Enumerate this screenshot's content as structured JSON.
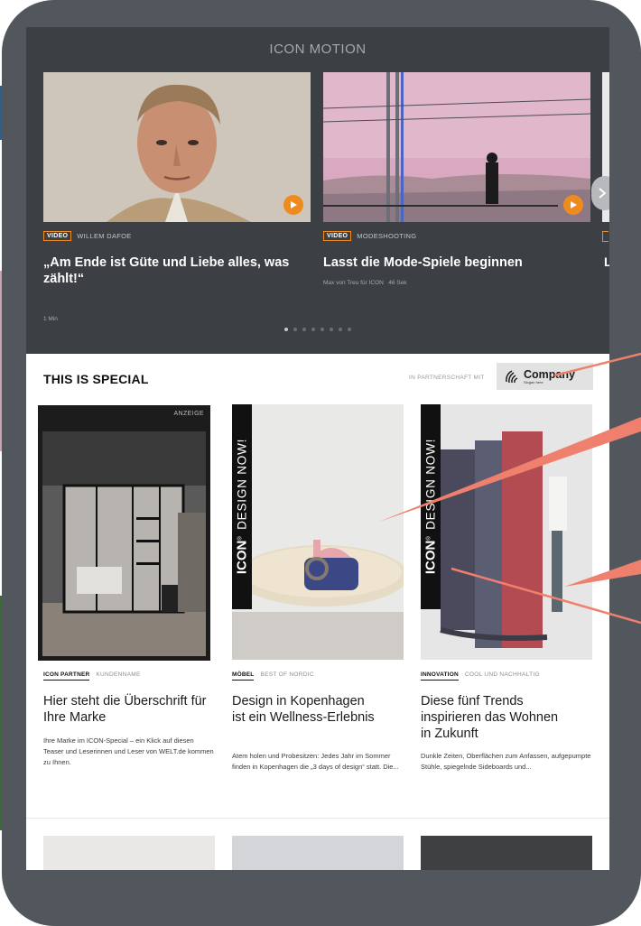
{
  "motion": {
    "title": "ICON MOTION",
    "cards": [
      {
        "tag": "VIDEO",
        "category": "WILLEM DAFOE",
        "headline": "„Am Ende ist Güte und Liebe alles, was zählt!“",
        "meta": "",
        "duration": "1 Min"
      },
      {
        "tag": "VIDEO",
        "category": "MODESHOOTING",
        "headline": "Lasst die Mode-Spiele beginnen",
        "meta": "Max von Treu für ICON",
        "duration": "46 Sek"
      }
    ],
    "peek_letter": "L",
    "dots_total": 8,
    "dots_active": 1
  },
  "special": {
    "title": "THIS IS SPECIAL",
    "partner_label": "IN PARTNERSCHAFT MIT",
    "company_name": "Company",
    "company_slogan": "Slogan here",
    "cards": [
      {
        "ad_label": "ANZEIGE",
        "tag": "ICON PARTNER",
        "subtag": "KUNDENNAME",
        "headline": "Hier steht die Überschrift für Ihre Marke",
        "body": "Ihre Marke im ICON-Special – ein Klick auf diesen Teaser und Leserinnen und Leser von WELT.de kommen zu Ihnen."
      },
      {
        "ribbon_brand": "ICON",
        "ribbon_suffix": "DESIGN NOW!",
        "tag": "MÖBEL",
        "subtag": "BEST OF NORDIC",
        "headline": "Design in Kopenhagen ist ein Wellness-Erlebnis",
        "body": "Atem holen und Probesitzen: Jedes Jahr im Sommer finden in Kopenhagen die „3 days of design“ statt. Die..."
      },
      {
        "ribbon_brand": "ICON",
        "ribbon_suffix": "DESIGN NOW!",
        "tag": "INNOVATION",
        "subtag": "COOL UND NACHHALTIG",
        "headline": "Diese fünf Trends inspirieren das Wohnen in Zukunft",
        "body": "Dunkle Zeiten, Oberflächen zum Anfassen, aufgepumpte Stühle, spiegelnde Sideboards und..."
      }
    ]
  },
  "colors": {
    "frame": "#51575d",
    "motion_bg": "#3c3f43",
    "accent_orange": "#ef8a1f",
    "callout": "#f0806e"
  },
  "icons": [
    "play-icon",
    "chevron-right-icon",
    "company-logo-icon"
  ]
}
